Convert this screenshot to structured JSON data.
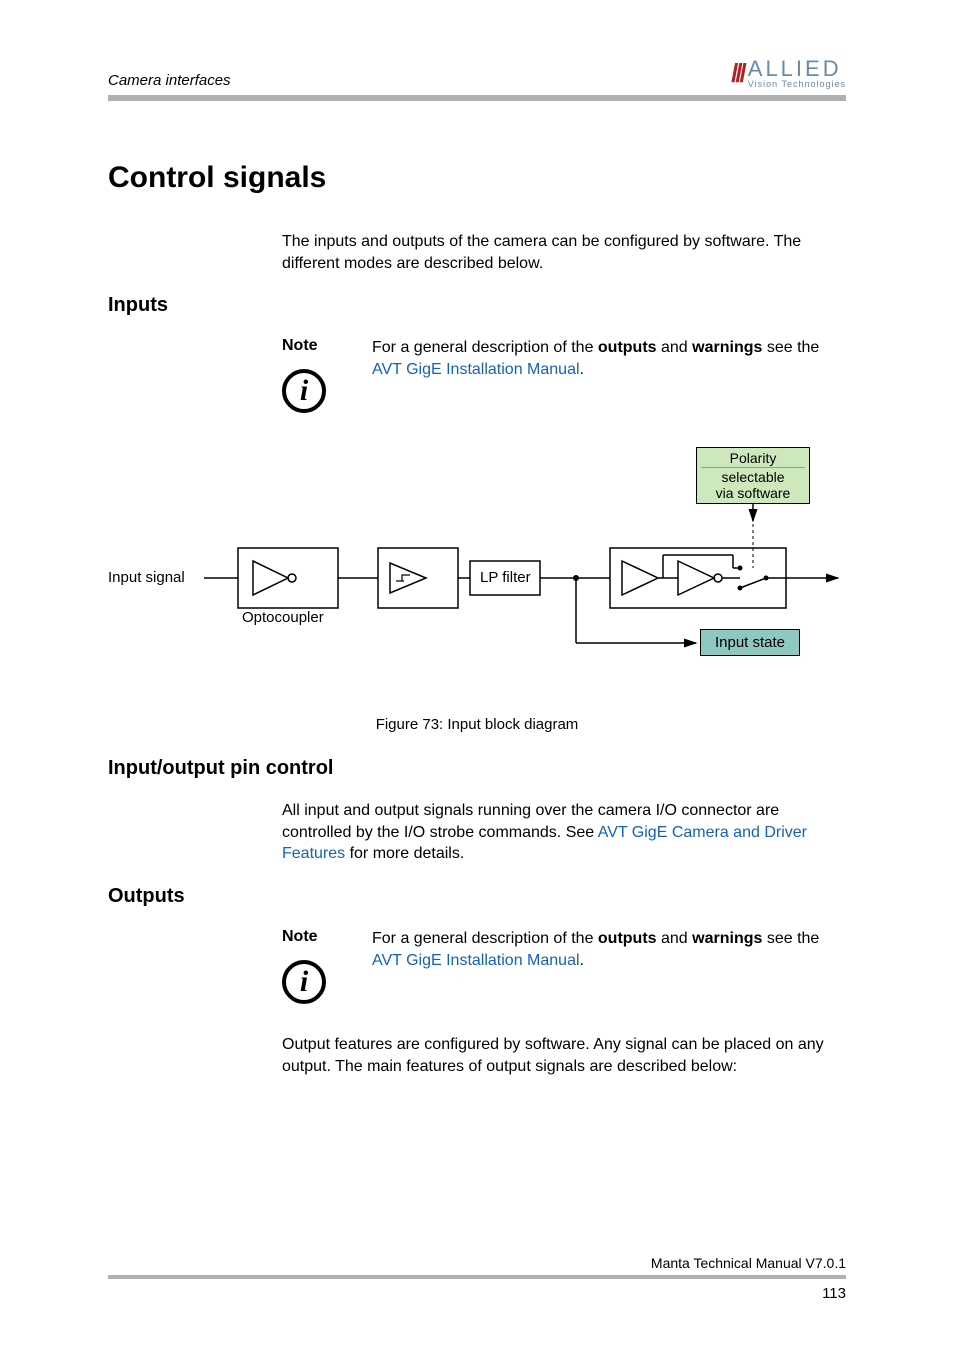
{
  "header": {
    "running_title": "Camera interfaces",
    "logo_main": "ALLIED",
    "logo_sub": "Vision Technologies"
  },
  "h1": "Control signals",
  "intro": "The inputs and outputs of the camera can be configured by software. The different modes are described below.",
  "sections": {
    "inputs": {
      "heading": "Inputs",
      "note_label": "Note",
      "note_pre": "For a general description of the ",
      "note_bold1": "outputs",
      "note_mid": " and ",
      "note_bold2": "warnings",
      "note_post": " see the ",
      "note_link": "AVT GigE Installation Manual",
      "note_end": "."
    },
    "diagram": {
      "input_signal": "Input signal",
      "optocoupler": "Optocoupler",
      "lp_filter": "LP filter",
      "polarity1": "Polarity",
      "polarity2": "selectable",
      "polarity3": "via software",
      "input_state": "Input state",
      "caption": "Figure 73: Input block diagram"
    },
    "io_control": {
      "heading": "Input/output pin control",
      "body_pre": "All input and output signals running over the camera I/O connector are controlled by the I/O strobe commands. See ",
      "body_link": "AVT GigE Camera and Driver Features",
      "body_post": " for more details."
    },
    "outputs": {
      "heading": "Outputs",
      "note_label": "Note",
      "note_pre": "For a general description of the ",
      "note_bold1": "outputs",
      "note_mid": " and ",
      "note_bold2": "warnings",
      "note_post": " see the ",
      "note_link": "AVT GigE Installation Manual",
      "note_end": ".",
      "body": "Output features are configured by software. Any signal can be placed on any output. The main features of output signals are described below:"
    }
  },
  "footer": {
    "manual": "Manta Technical Manual V7.0.1",
    "page": "113"
  }
}
